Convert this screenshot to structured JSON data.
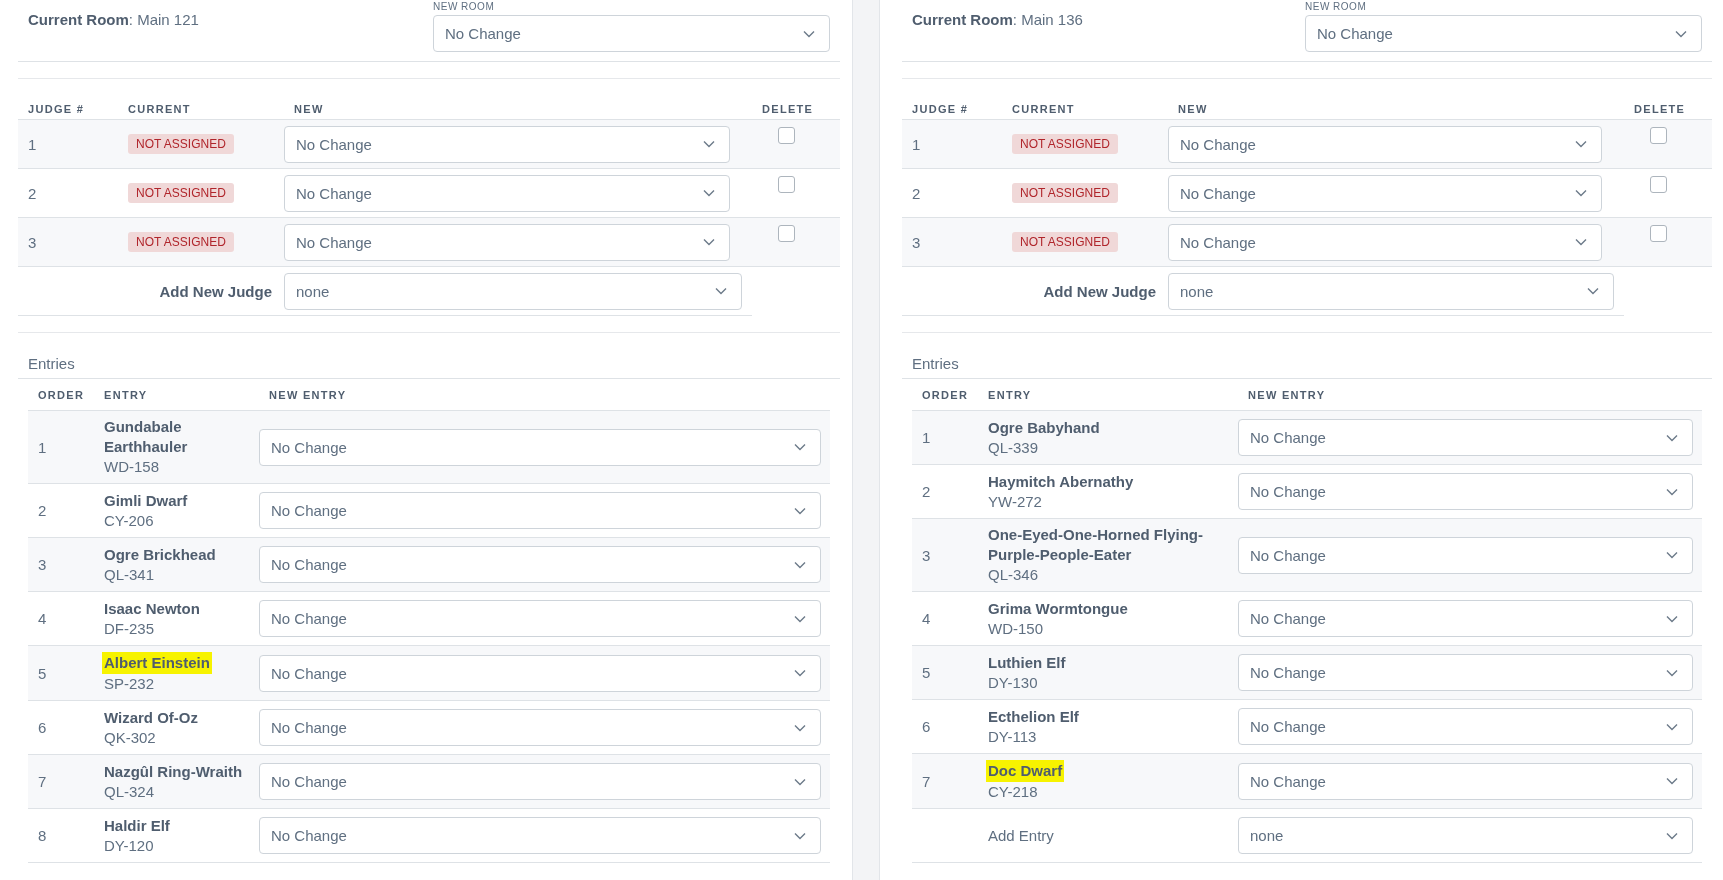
{
  "panels": [
    {
      "current_room": "**Current Room**: Main 121",
      "new_room": {
        "label": "NEW ROOM",
        "value": "No Change"
      },
      "judges": {
        "columns": [
          "JUDGE #",
          "CURRENT",
          "NEW",
          "DELETE"
        ],
        "rows": [
          {
            "number": "1",
            "current": "NOT ASSIGNED",
            "new": "No Change",
            "delete": false
          },
          {
            "number": "2",
            "current": "NOT ASSIGNED",
            "new": "No Change",
            "delete": false
          },
          {
            "number": "3",
            "current": "NOT ASSIGNED",
            "new": "No Change",
            "delete": false
          }
        ],
        "add_label": "Add New Judge",
        "add_value": "none"
      },
      "entries": {
        "title": "Entries",
        "columns": [
          "ORDER",
          "ENTRY",
          "NEW ENTRY"
        ],
        "rows": [
          {
            "order": "1",
            "name": "Gundabale Earthhauler",
            "code": "WD-158",
            "new": "No Change",
            "highlighted": false
          },
          {
            "order": "2",
            "name": "Gimli Dwarf",
            "code": "CY-206",
            "new": "No Change",
            "highlighted": false
          },
          {
            "order": "3",
            "name": "Ogre Brickhead",
            "code": "QL-341",
            "new": "No Change",
            "highlighted": false
          },
          {
            "order": "4",
            "name": "Isaac Newton",
            "code": "DF-235",
            "new": "No Change",
            "highlighted": false
          },
          {
            "order": "5",
            "name": "Albert Einstein",
            "code": "SP-232",
            "new": "No Change",
            "highlighted": true
          },
          {
            "order": "6",
            "name": "Wizard Of-Oz",
            "code": "QK-302",
            "new": "No Change",
            "highlighted": false
          },
          {
            "order": "7",
            "name": "Nazgûl Ring-Wraith",
            "code": "QL-324",
            "new": "No Change",
            "highlighted": false
          },
          {
            "order": "8",
            "name": "Haldir Elf",
            "code": "DY-120",
            "new": "No Change",
            "highlighted": false
          }
        ]
      }
    },
    {
      "current_room": "**Current Room**: Main 136",
      "new_room": {
        "label": "NEW ROOM",
        "value": "No Change"
      },
      "judges": {
        "columns": [
          "JUDGE #",
          "CURRENT",
          "NEW",
          "DELETE"
        ],
        "rows": [
          {
            "number": "1",
            "current": "NOT ASSIGNED",
            "new": "No Change",
            "delete": false
          },
          {
            "number": "2",
            "current": "NOT ASSIGNED",
            "new": "No Change",
            "delete": false
          },
          {
            "number": "3",
            "current": "NOT ASSIGNED",
            "new": "No Change",
            "delete": false
          }
        ],
        "add_label": "Add New Judge",
        "add_value": "none"
      },
      "entries": {
        "title": "Entries",
        "columns": [
          "ORDER",
          "ENTRY",
          "NEW ENTRY"
        ],
        "rows": [
          {
            "order": "1",
            "name": "Ogre Babyhand",
            "code": "QL-339",
            "new": "No Change",
            "highlighted": false
          },
          {
            "order": "2",
            "name": "Haymitch Abernathy",
            "code": "YW-272",
            "new": "No Change",
            "highlighted": false
          },
          {
            "order": "3",
            "name": "One-Eyed-One-Horned Flying-Purple-People-Eater",
            "code": "QL-346",
            "new": "No Change",
            "highlighted": false
          },
          {
            "order": "4",
            "name": "Grima Wormtongue",
            "code": "WD-150",
            "new": "No Change",
            "highlighted": false
          },
          {
            "order": "5",
            "name": "Luthien Elf",
            "code": "DY-130",
            "new": "No Change",
            "highlighted": false
          },
          {
            "order": "6",
            "name": "Ecthelion Elf",
            "code": "DY-113",
            "new": "No Change",
            "highlighted": false
          },
          {
            "order": "7",
            "name": "Doc Dwarf",
            "code": "CY-218",
            "new": "No Change",
            "highlighted": true
          }
        ],
        "add_label": "Add Entry",
        "add_value": "none"
      }
    }
  ]
}
